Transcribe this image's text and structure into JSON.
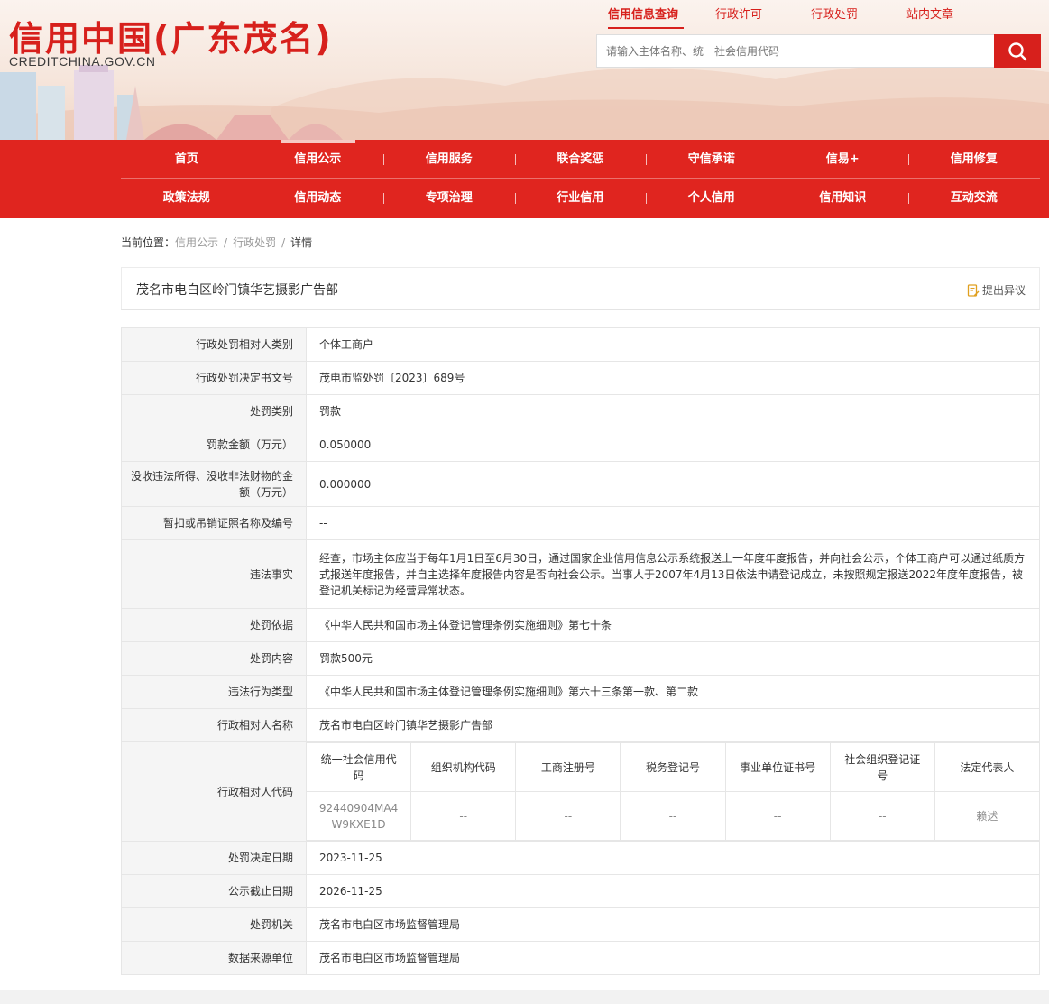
{
  "header": {
    "logo_cn": "信用中国(广东茂名)",
    "logo_en": "CREDITCHINA.GOV.CN",
    "top_tabs": [
      "信用信息查询",
      "行政许可",
      "行政处罚",
      "站内文章"
    ],
    "search_placeholder": "请输入主体名称、统一社会信用代码",
    "search_icon": "search-icon",
    "accent": "#e0251f"
  },
  "nav": {
    "row1": [
      "首页",
      "信用公示",
      "信用服务",
      "联合奖惩",
      "守信承诺",
      "信易+",
      "信用修复"
    ],
    "row2": [
      "政策法规",
      "信用动态",
      "专项治理",
      "行业信用",
      "个人信用",
      "信用知识",
      "互动交流"
    ]
  },
  "breadcrumb": {
    "prefix": "当前位置：",
    "items": [
      "信用公示",
      "行政处罚",
      "详情"
    ],
    "sep": "/"
  },
  "record": {
    "title": "茂名市电白区岭门镇华艺摄影广告部",
    "objection_label": "提出异议",
    "rows": [
      {
        "k": "行政处罚相对人类别",
        "v": "个体工商户"
      },
      {
        "k": "行政处罚决定书文号",
        "v": "茂电市监处罚〔2023〕689号"
      },
      {
        "k": "处罚类别",
        "v": "罚款"
      },
      {
        "k": "罚款金额（万元）",
        "v": "0.050000"
      },
      {
        "k": "没收违法所得、没收非法财物的金额（万元）",
        "v": "0.000000"
      },
      {
        "k": "暂扣或吊销证照名称及编号",
        "v": "--"
      },
      {
        "k": "违法事实",
        "v": "经查，市场主体应当于每年1月1日至6月30日，通过国家企业信用信息公示系统报送上一年度年度报告，并向社会公示，个体工商户可以通过纸质方式报送年度报告，并自主选择年度报告内容是否向社会公示。当事人于2007年4月13日依法申请登记成立，未按照规定报送2022年度年度报告，被登记机关标记为经营异常状态。"
      },
      {
        "k": "处罚依据",
        "v": "《中华人民共和国市场主体登记管理条例实施细则》第七十条"
      },
      {
        "k": "处罚内容",
        "v": "罚款500元"
      },
      {
        "k": "违法行为类型",
        "v": "《中华人民共和国市场主体登记管理条例实施细则》第六十三条第一款、第二款"
      },
      {
        "k": "行政相对人名称",
        "v": "茂名市电白区岭门镇华艺摄影广告部"
      }
    ],
    "code_label": "行政相对人代码",
    "code_headers": [
      "统一社会信用代码",
      "组织机构代码",
      "工商注册号",
      "税务登记号",
      "事业单位证书号",
      "社会组织登记证号",
      "法定代表人"
    ],
    "code_values": [
      "92440904MA4W9KXE1D",
      "--",
      "--",
      "--",
      "--",
      "--",
      "赖迖"
    ],
    "rows_after": [
      {
        "k": "处罚决定日期",
        "v": "2023-11-25"
      },
      {
        "k": "公示截止日期",
        "v": "2026-11-25"
      },
      {
        "k": "处罚机关",
        "v": "茂名市电白区市场监督管理局"
      },
      {
        "k": "数据来源单位",
        "v": "茂名市电白区市场监督管理局"
      }
    ]
  }
}
